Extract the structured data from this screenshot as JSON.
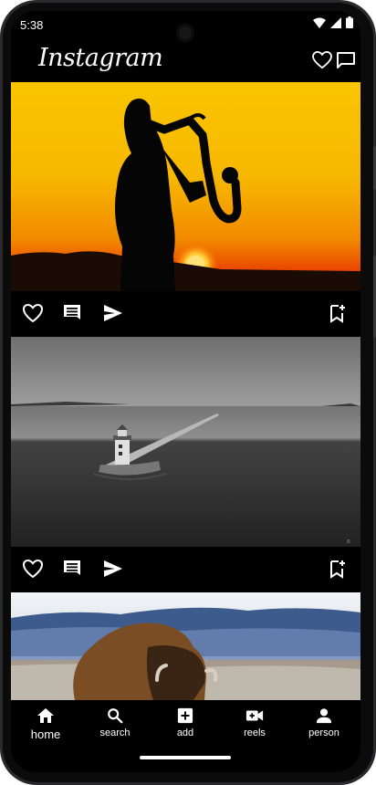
{
  "status_bar": {
    "time": "5:38",
    "icons": [
      "wifi-icon",
      "signal-icon",
      "battery-icon"
    ]
  },
  "header": {
    "title": "Instagram",
    "actions": [
      "heart-icon",
      "message-icon"
    ]
  },
  "posts": [
    {
      "image": "saxophone player silhouette at sunset",
      "actions": [
        "heart-icon",
        "comment-icon",
        "send-icon",
        "bookmark-add-icon"
      ]
    },
    {
      "image": "black and white lighthouse at end of a pier",
      "actions": [
        "heart-icon",
        "comment-icon",
        "send-icon",
        "bookmark-add-icon"
      ]
    },
    {
      "image": "bison in snowy field",
      "actions": []
    }
  ],
  "bottom_nav": {
    "items": [
      {
        "label": "home",
        "icon": "home-icon",
        "active": true
      },
      {
        "label": "search",
        "icon": "search-icon",
        "active": false
      },
      {
        "label": "add",
        "icon": "add-box-icon",
        "active": false
      },
      {
        "label": "reels",
        "icon": "video-camera-icon",
        "active": false
      },
      {
        "label": "person",
        "icon": "person-icon",
        "active": false
      }
    ]
  },
  "colors": {
    "background": "#000000",
    "text": "#ffffff",
    "device_frame": "#2a2a2c"
  }
}
